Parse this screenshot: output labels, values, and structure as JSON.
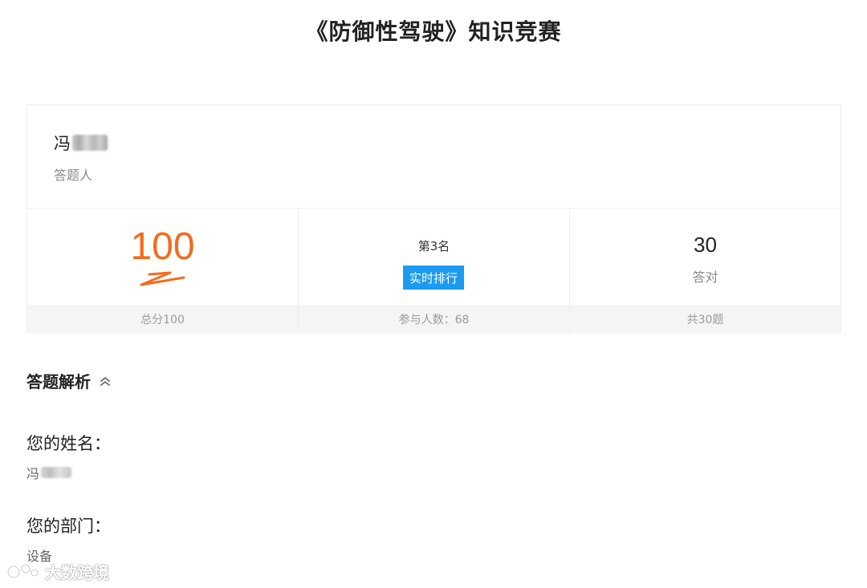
{
  "page": {
    "title": "《防御性驾驶》知识竞赛"
  },
  "respondent": {
    "name_visible": "冯",
    "role_label": "答题人"
  },
  "stats": {
    "score": {
      "value": "100",
      "footer": "总分100"
    },
    "rank": {
      "text": "第3名",
      "button_label": "实时排行",
      "footer": "参与人数：68"
    },
    "correct": {
      "value": "30",
      "label": "答对",
      "footer": "共30题"
    }
  },
  "analysis": {
    "title": "答题解析",
    "toggle_icon": "double-chevron-up-icon"
  },
  "questions": [
    {
      "question": "您的姓名：",
      "answer_visible": "冯"
    },
    {
      "question": "您的部门：",
      "answer": "设备"
    }
  ],
  "watermark": {
    "text": "大数跨境"
  },
  "colors": {
    "score": "#f26b1d",
    "accent": "#1a9bf0",
    "footer_bg": "#f5f5f5"
  }
}
